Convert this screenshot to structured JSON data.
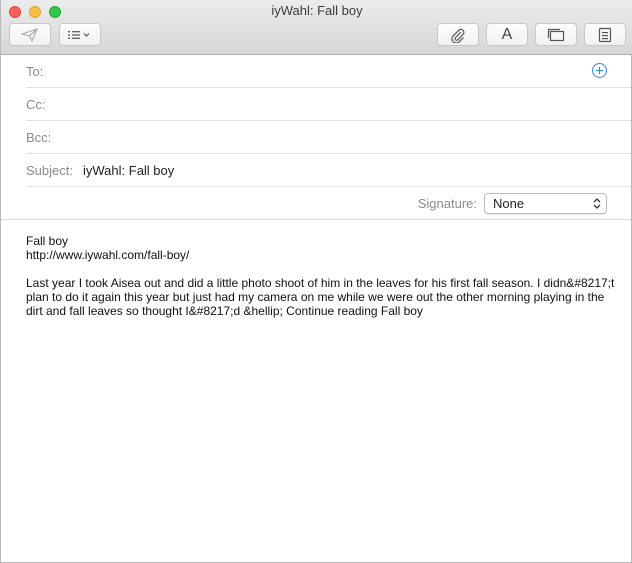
{
  "window": {
    "title": "iyWahl: Fall boy"
  },
  "toolbar": {
    "send": {
      "icon": "send-icon"
    },
    "header_fields": {
      "icon": "list-icon"
    },
    "attach": {
      "icon": "paperclip-icon"
    },
    "format": {
      "label": "A",
      "icon": "font-icon"
    },
    "browser": {
      "icon": "browser-icon"
    },
    "photo": {
      "icon": "photo-browser-icon"
    }
  },
  "header": {
    "to_label": "To:",
    "cc_label": "Cc:",
    "bcc_label": "Bcc:",
    "subject_label": "Subject:",
    "subject_value": "iyWahl: Fall boy",
    "signature_label": "Signature:",
    "signature_value": "None",
    "colors": {
      "accent": "#2c8ce8"
    }
  },
  "message": {
    "line1": "Fall boy",
    "line2": "http://www.iywahl.com/fall-boy/",
    "paragraph": "Last year I took Aisea out and did a little photo shoot of him in the leaves for his first fall season. I didn&#8217;t plan to do it again this year but just had my camera on me while we were out the other morning playing in the dirt and fall leaves so thought I&#8217;d &hellip; Continue reading Fall boy"
  }
}
